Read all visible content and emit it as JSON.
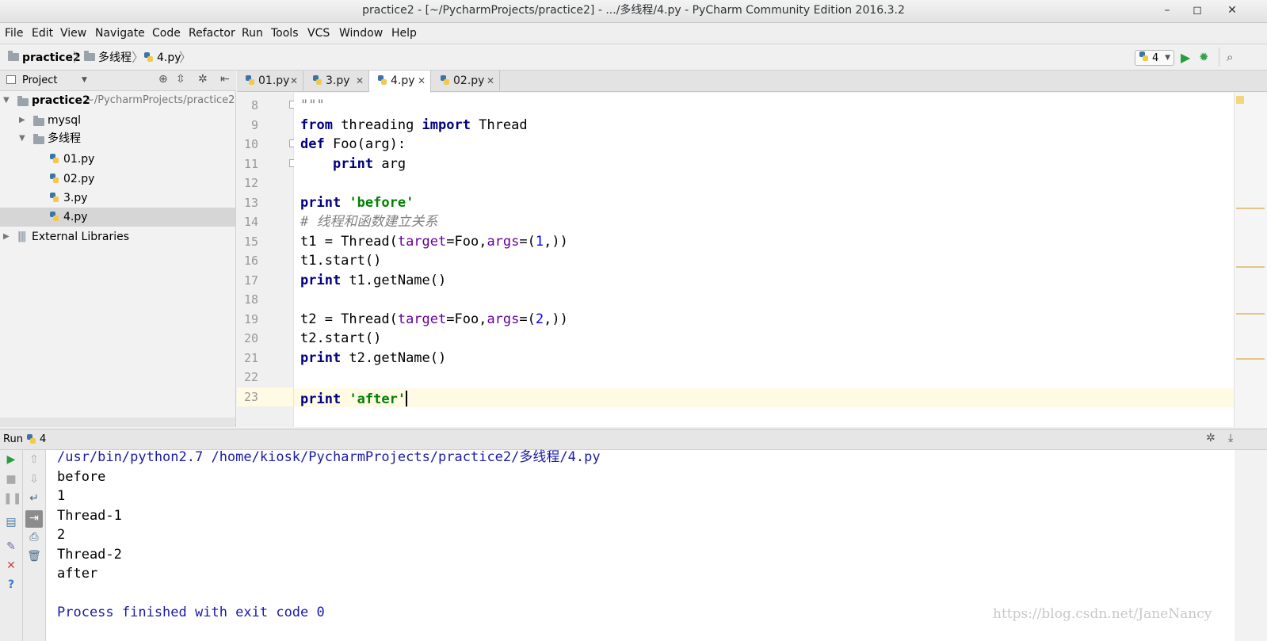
{
  "window": {
    "title": "practice2 - [~/PycharmProjects/practice2] - .../多线程/4.py - PyCharm Community Edition 2016.3.2"
  },
  "menu": [
    "File",
    "Edit",
    "View",
    "Navigate",
    "Code",
    "Refactor",
    "Run",
    "Tools",
    "VCS",
    "Window",
    "Help"
  ],
  "breadcrumb": {
    "project": "practice2",
    "folder": "多线程",
    "file": "4.py"
  },
  "run_config": {
    "name": "4"
  },
  "project_panel": {
    "title": "Project",
    "root": {
      "name": "practice2",
      "path": "~/PycharmProjects/practice2"
    },
    "items": {
      "mysql": "mysql",
      "folder": "多线程",
      "f1": "01.py",
      "f2": "02.py",
      "f3": "3.py",
      "f4": "4.py",
      "ext": "External Libraries"
    }
  },
  "tabs": [
    "01.py",
    "3.py",
    "4.py",
    "02.py"
  ],
  "editor": {
    "line_numbers": [
      "8",
      "9",
      "10",
      "11",
      "12",
      "13",
      "14",
      "15",
      "16",
      "17",
      "18",
      "19",
      "20",
      "21",
      "22",
      "23"
    ],
    "tokens": {
      "l8": "\"\"\"",
      "from": "from",
      "threading": " threading ",
      "import": "import",
      "Thread": " Thread",
      "def": "def",
      "foo_sig": " Foo(arg):",
      "print": "print",
      "arg": " arg",
      "before_str": "'before'",
      "comment": "# 线程和函数建立关系",
      "t1_pre": "t1 = Thread(",
      "target": "target",
      "eqfoo": "=Foo,",
      "args": "args",
      "eqp": "=(",
      "one": "1",
      "close": ",))",
      "t1_start": "t1.start()",
      "t1_getname": " t1.getName()",
      "t2_pre": "t2 = Thread(",
      "two": "2",
      "t2_start": "t2.start()",
      "t2_getname": " t2.getName()",
      "after_str": "'after'",
      "space": " "
    }
  },
  "run_panel": {
    "label": "Run",
    "config": "4",
    "output": [
      "/usr/bin/python2.7 /home/kiosk/PycharmProjects/practice2/多线程/4.py",
      "before",
      "1",
      "Thread-1",
      "2",
      "Thread-2",
      "after",
      "",
      "Process finished with exit code 0"
    ]
  },
  "watermark": "https://blog.csdn.net/JaneNancy"
}
